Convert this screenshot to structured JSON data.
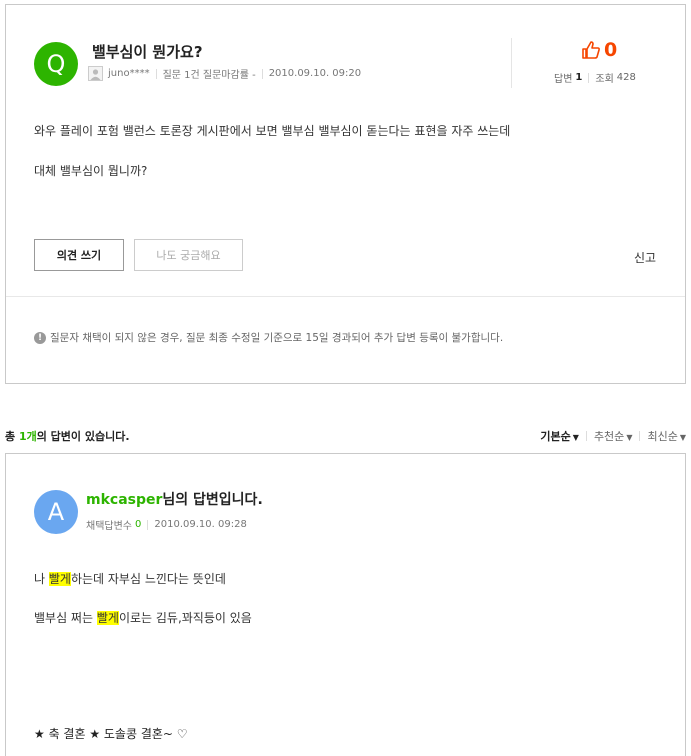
{
  "question": {
    "badge": "Q",
    "title": "밸부심이 뭔가요?",
    "author": "juno****",
    "author_info": "질문 1건 질문마감률 -",
    "date": "2010.09.10. 09:20",
    "like_count": "0",
    "answers_label": "답변",
    "answers_count": "1",
    "views_label": "조회",
    "views_count": "428",
    "body": [
      "와우 플레이 포험  밸런스 토론장 게시판에서 보면 밸부심 밸부심이 돋는다는 표현을 자주 쓰는데",
      "대체 밸부심이 뭡니까?"
    ],
    "btn_opinion": "의견 쓰기",
    "btn_curious": "나도 궁금해요",
    "report": "신고",
    "notice": "질문자 채택이 되지 않은 경우, 질문 최종 수정일 기준으로 15일 경과되어 추가 답변 등록이 불가합니다."
  },
  "answers_bar": {
    "prefix": "총 ",
    "count": "1개",
    "suffix": "의 답변이 있습니다.",
    "sort": [
      "기본순",
      "추천순",
      "최신순"
    ]
  },
  "answer": {
    "badge": "A",
    "author": "mkcasper",
    "title_suffix": "님의 답변입니다.",
    "adopted_label": "채택답변수",
    "adopted_count": "0",
    "date": "2010.09.10. 09:28",
    "line1_pre": "나 ",
    "line1_hl": "빨게",
    "line1_post": "하는데 자부심 느낀다는 뜻인데",
    "line2_pre": "밸부심 쩌는 ",
    "line2_hl": "빨게",
    "line2_post": "이로는 김듀,꽈직등이 있음",
    "footer": "★ 축 결혼 ★ 도솔콩 결혼~ ♡"
  },
  "colors": {
    "naver_green": "#2db400",
    "like_red": "#f64600",
    "answer_badge": "#6aa7f0",
    "highlight": "#ffff00"
  }
}
